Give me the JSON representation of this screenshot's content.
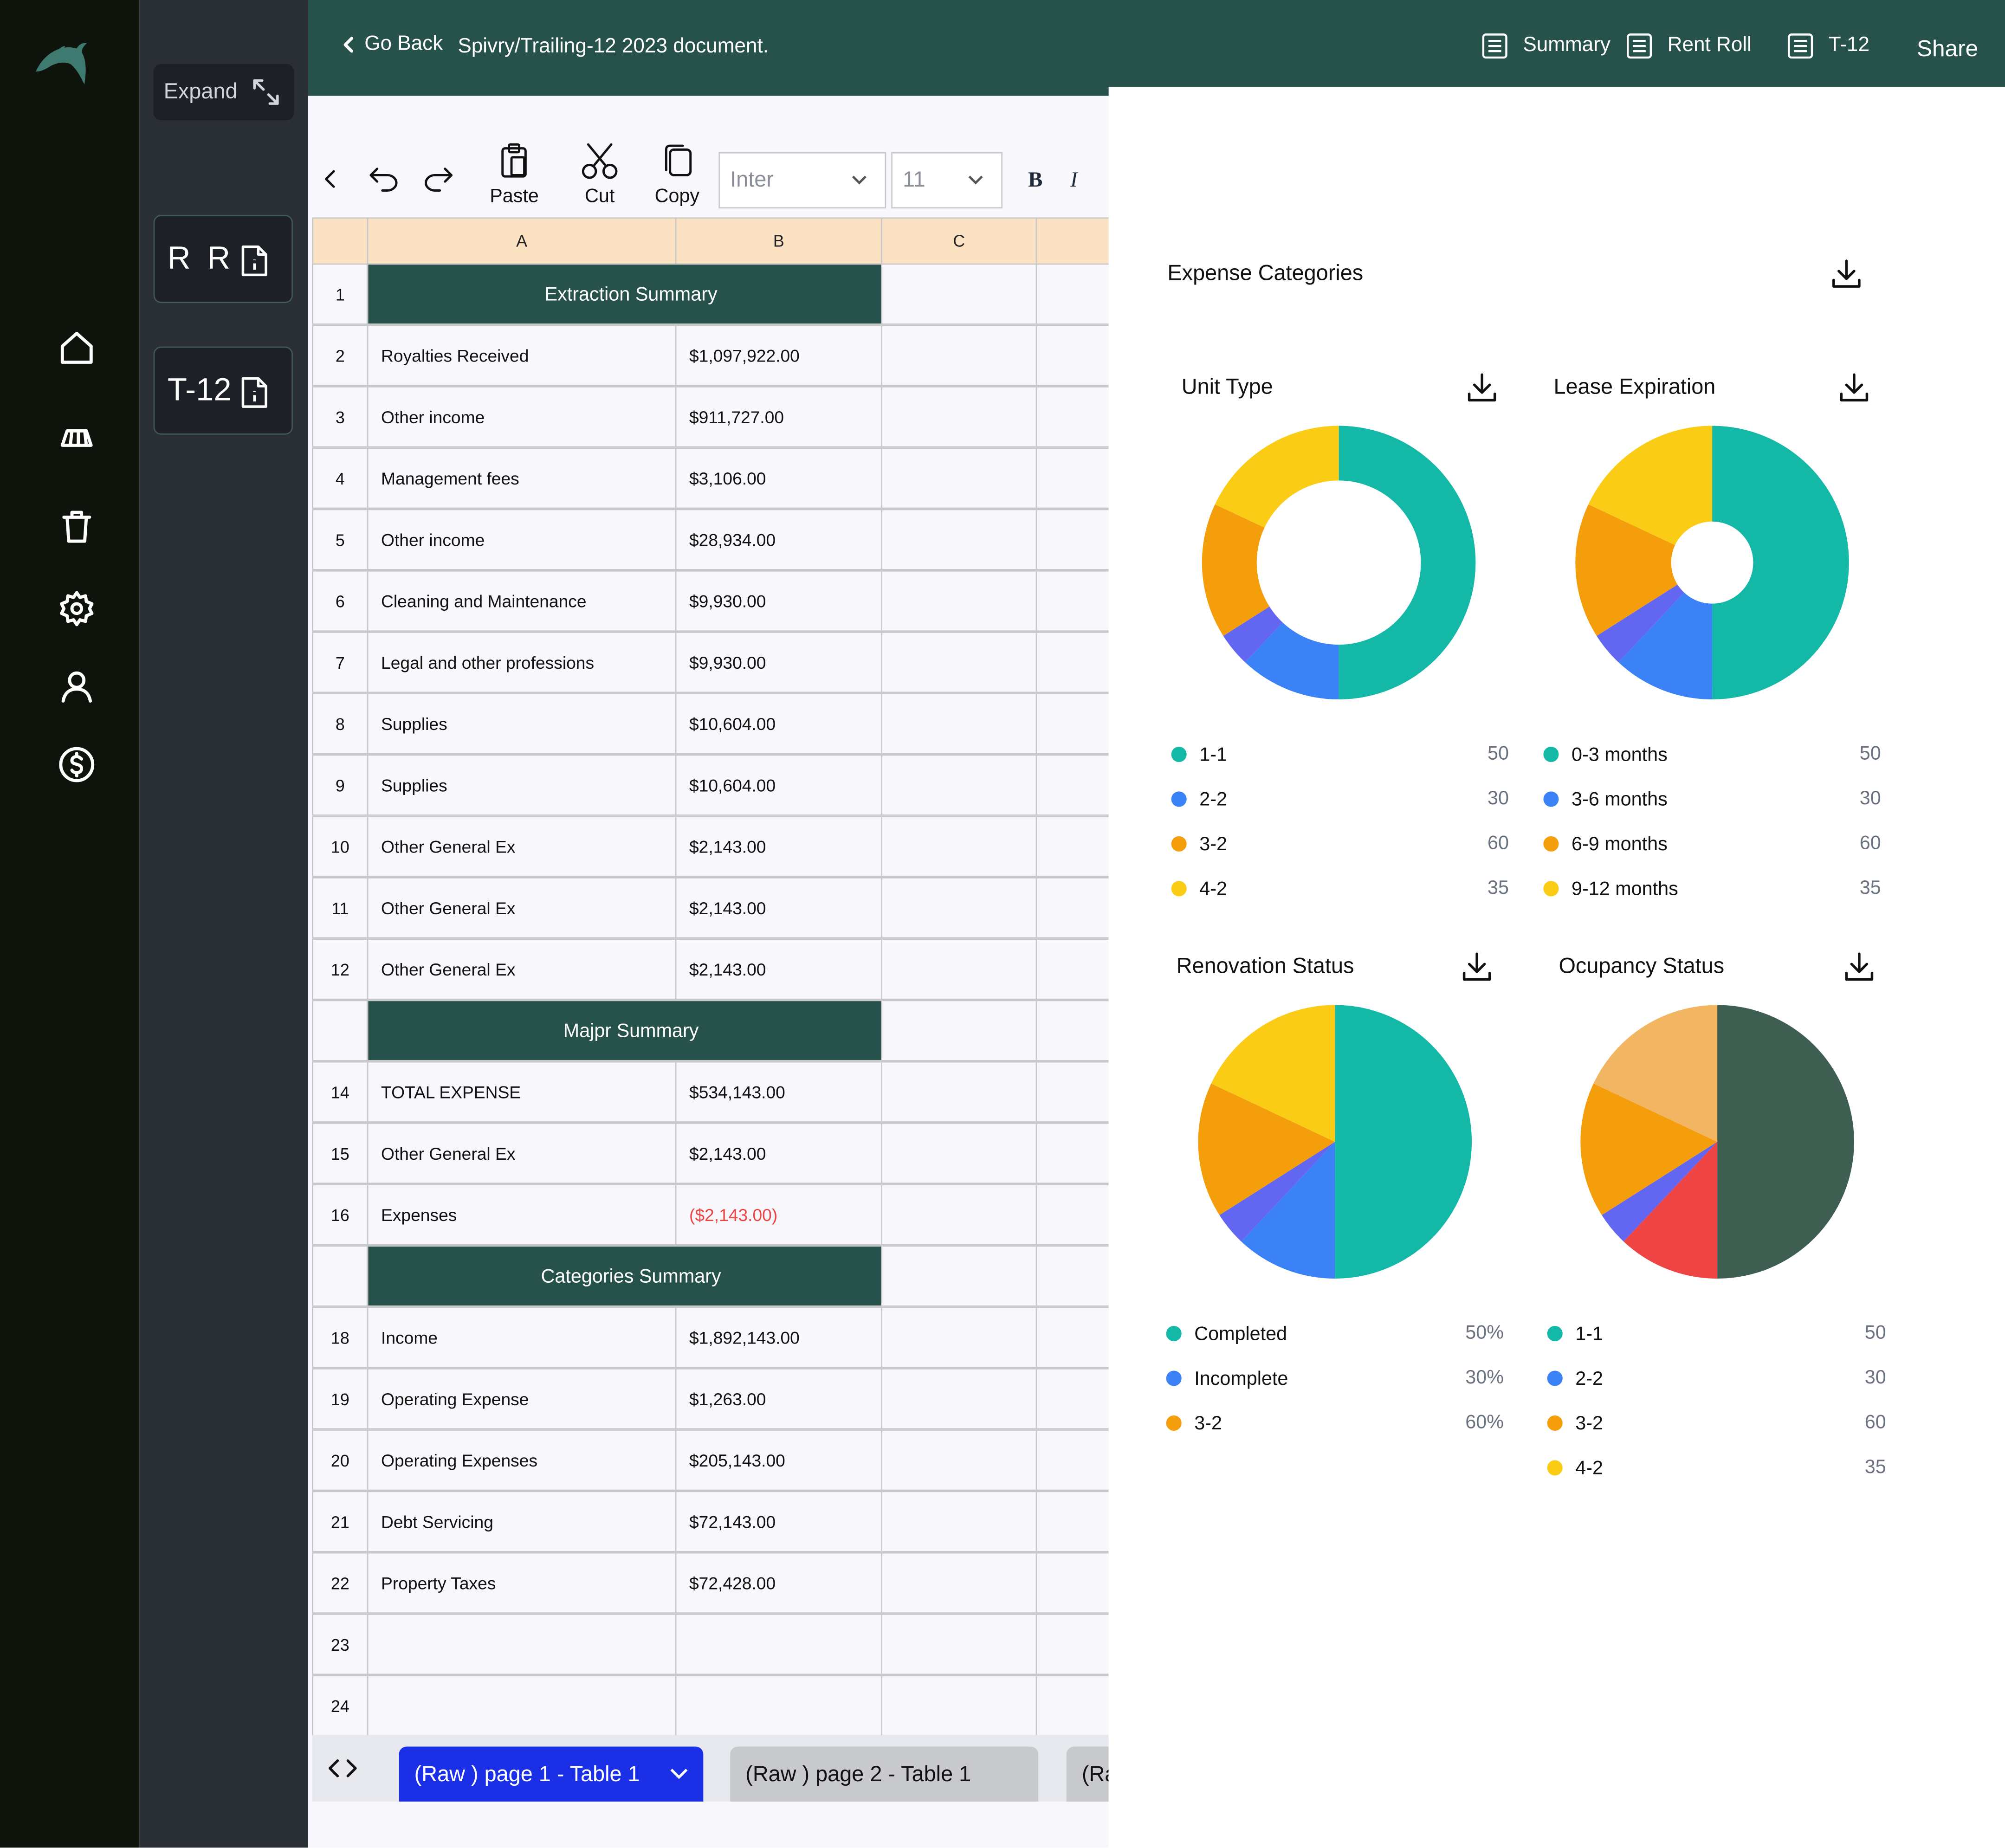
{
  "header": {
    "back_label": "Go Back",
    "doc_title": "Spivry/Trailing-12 2023 document.",
    "tabs": [
      {
        "label": "Summary",
        "icon": "table-icon"
      },
      {
        "label": "Rent Roll",
        "icon": "table-icon"
      },
      {
        "label": "T-12",
        "icon": "table-icon"
      }
    ],
    "share_label": "Share"
  },
  "rail": {
    "logo": "dolphin-logo",
    "icons": [
      "home-icon",
      "layers-icon",
      "trash-icon",
      "gear-icon",
      "user-icon",
      "dollar-icon"
    ]
  },
  "sidebar": {
    "expand_label": "Expand",
    "docs": [
      {
        "label": "R R",
        "icon": "file-info-icon"
      },
      {
        "label": "T-12",
        "icon": "file-info-icon"
      }
    ]
  },
  "toolbar": {
    "paste_label": "Paste",
    "cut_label": "Cut",
    "copy_label": "Copy",
    "font_value": "Inter",
    "size_value": "11",
    "bold_label": "B",
    "italic_label": "I"
  },
  "sheet": {
    "columns": [
      "A",
      "B",
      "C"
    ],
    "rows": [
      {
        "num": "1",
        "a": "Extraction Summary",
        "b": "",
        "header": true
      },
      {
        "num": "2",
        "a": "Royalties Received",
        "b": "$1,097,922.00"
      },
      {
        "num": "3",
        "a": "Other income",
        "b": "$911,727.00"
      },
      {
        "num": "4",
        "a": "Management fees",
        "b": "$3,106.00"
      },
      {
        "num": "5",
        "a": "Other income",
        "b": "$28,934.00"
      },
      {
        "num": "6",
        "a": "Cleaning and Maintenance",
        "b": "$9,930.00"
      },
      {
        "num": "7",
        "a": "Legal and other professions",
        "b": "$9,930.00"
      },
      {
        "num": "8",
        "a": "Supplies",
        "b": "$10,604.00"
      },
      {
        "num": "9",
        "a": "Supplies",
        "b": "$10,604.00"
      },
      {
        "num": "10",
        "a": "Other General Ex",
        "b": "$2,143.00"
      },
      {
        "num": "11",
        "a": "Other General Ex",
        "b": "$2,143.00"
      },
      {
        "num": "12",
        "a": "Other General Ex",
        "b": "$2,143.00"
      },
      {
        "num": "",
        "a": "Majpr Summary",
        "b": "",
        "header": true
      },
      {
        "num": "14",
        "a": "TOTAL EXPENSE",
        "b": "$534,143.00"
      },
      {
        "num": "15",
        "a": "Other General Ex",
        "b": "$2,143.00"
      },
      {
        "num": "16",
        "a": "Expenses",
        "b": "($2,143.00)",
        "negative": true
      },
      {
        "num": "",
        "a": "Categories Summary",
        "b": "",
        "header": true
      },
      {
        "num": "18",
        "a": "Income",
        "b": "$1,892,143.00"
      },
      {
        "num": "19",
        "a": "Operating Expense",
        "b": "$1,263.00"
      },
      {
        "num": "20",
        "a": "Operating Expenses",
        "b": "$205,143.00"
      },
      {
        "num": "21",
        "a": "Debt Servicing",
        "b": "$72,143.00"
      },
      {
        "num": "22",
        "a": "Property Taxes",
        "b": "$72,428.00"
      },
      {
        "num": "23",
        "a": "",
        "b": ""
      },
      {
        "num": "24",
        "a": "",
        "b": ""
      }
    ],
    "negative_color": "#ef4444",
    "header_color": "#27524b"
  },
  "sheet_tabs": [
    "(Raw ) page 1 - Table 1",
    "(Raw ) page 2 - Table 1",
    "(Ra"
  ],
  "panel": {
    "title": "Expense Categories"
  },
  "chart_data": [
    {
      "type": "pie",
      "title": "Unit Type",
      "categories": [
        "1-1",
        "2-2",
        "3-2",
        "4-2"
      ],
      "values": [
        50,
        30,
        60,
        35
      ],
      "value_labels": [
        "50",
        "30",
        "60",
        "35"
      ],
      "slices_pct": [
        50,
        12,
        4,
        16,
        18
      ],
      "colors": [
        "#14b8a6",
        "#3b82f6",
        "#6366f1",
        "#f59e0b",
        "#facc15"
      ],
      "legend_colors": [
        "#14b8a6",
        "#3b82f6",
        "#f59e0b",
        "#facc15"
      ],
      "hole": 0.6
    },
    {
      "type": "pie",
      "title": "Lease Expiration",
      "categories": [
        "0-3 months",
        "3-6 months",
        "6-9 months",
        "9-12 months"
      ],
      "values": [
        50,
        30,
        60,
        35
      ],
      "value_labels": [
        "50",
        "30",
        "60",
        "35"
      ],
      "slices_pct": [
        50,
        12,
        4,
        16,
        18
      ],
      "colors": [
        "#14b8a6",
        "#3b82f6",
        "#6366f1",
        "#f59e0b",
        "#facc15"
      ],
      "legend_colors": [
        "#14b8a6",
        "#3b82f6",
        "#f59e0b",
        "#facc15"
      ],
      "hole": 0.3
    },
    {
      "type": "pie",
      "title": "Renovation Status",
      "categories": [
        "Completed",
        "Incomplete",
        "3-2"
      ],
      "values": [
        50,
        30,
        60
      ],
      "value_labels": [
        "50%",
        "30%",
        "60%"
      ],
      "slices_pct": [
        50,
        12,
        4,
        16,
        18
      ],
      "colors": [
        "#14b8a6",
        "#3b82f6",
        "#6366f1",
        "#f59e0b",
        "#facc15"
      ],
      "legend_colors": [
        "#14b8a6",
        "#3b82f6",
        "#f59e0b"
      ],
      "hole": 0
    },
    {
      "type": "pie",
      "title": "Ocupancy Status",
      "categories": [
        "1-1",
        "2-2",
        "3-2",
        "4-2"
      ],
      "values": [
        50,
        30,
        60,
        35
      ],
      "value_labels": [
        "50",
        "30",
        "60",
        "35"
      ],
      "slices_pct": [
        50,
        12,
        4,
        16,
        18
      ],
      "colors": [
        "#3f5e52",
        "#ef4444",
        "#6366f1",
        "#f59e0b",
        "#f2b662"
      ],
      "legend_colors": [
        "#14b8a6",
        "#3b82f6",
        "#f59e0b",
        "#facc15"
      ],
      "hole": 0
    }
  ]
}
